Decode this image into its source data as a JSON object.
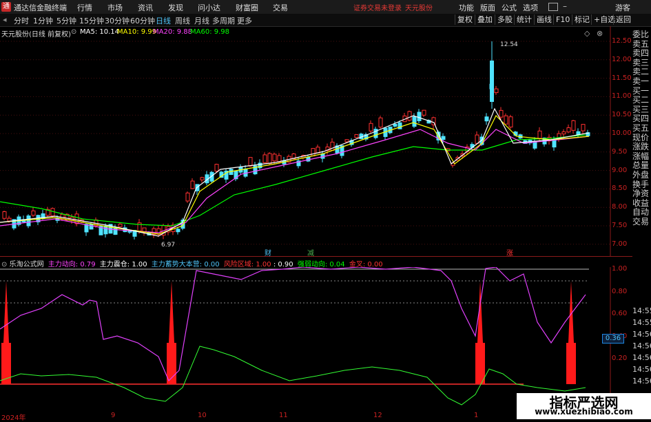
{
  "menubar": {
    "app_title": "通达信金融终端",
    "items": [
      "行情",
      "市场",
      "资讯",
      "发现",
      "问小达",
      "财富圈",
      "交易"
    ],
    "notice": "证券交易未登录",
    "notice_stock": "天元股份",
    "right_items": [
      "功能",
      "版面",
      "公式",
      "选项"
    ],
    "guest": "游客"
  },
  "periodbar": {
    "items": [
      "分时",
      "1分钟",
      "5分钟",
      "15分钟",
      "30分钟",
      "60分钟",
      "日线",
      "周线",
      "月线",
      "多周期",
      "更多"
    ],
    "active": "日线",
    "tools": [
      "复权",
      "叠加",
      "多股",
      "统计",
      "画线",
      "F10",
      "标记",
      "+自选",
      "返回"
    ]
  },
  "main_info": {
    "title": "天元股份(日线 前复权)",
    "ma5": "MA5: 10.14",
    "ma10": "MA10: 9.99",
    "ma20": "MA20: 9.88",
    "ma60": "MA60: 9.98",
    "colors": {
      "ma5": "#ffffff",
      "ma10": "#ffff00",
      "ma20": "#ff44ff",
      "ma60": "#00ff00"
    }
  },
  "price_axis": [
    "12.50",
    "12.00",
    "11.50",
    "11.00",
    "10.50",
    "10.00",
    "9.50",
    "9.00",
    "8.50",
    "8.00",
    "7.50",
    "7.00"
  ],
  "price_labels": {
    "high": "12.54",
    "low": "6.97"
  },
  "markers": [
    "财",
    "减",
    "涨"
  ],
  "sub_info": {
    "title": "乐淘公式网",
    "items": [
      {
        "label": "主力动向: 0.79",
        "color": "#ff44ff"
      },
      {
        "label": "主力震仓: 1.00",
        "color": "#ffffff"
      },
      {
        "label": "主力蓄势大本营: 0.00",
        "color": "#4fc3f7"
      },
      {
        "label": "风险区域: 1.00",
        "color": "#ff3333"
      },
      {
        "label": ": 0.90",
        "color": "#ffffff"
      },
      {
        "label": "强弱动向: 0.04",
        "color": "#00ff00"
      },
      {
        "label": "金叉: 0.00",
        "color": "#ff3333"
      }
    ]
  },
  "sub_axis": [
    "1.00",
    "0.80",
    "0.60",
    "0.40",
    "0.20"
  ],
  "sub_value_box": "0.36",
  "right_panel": [
    "委比",
    "卖五",
    "卖四",
    "卖三",
    "卖二",
    "卖一",
    "买一",
    "买二",
    "买三",
    "买四",
    "买五",
    "现价",
    "涨跌",
    "涨幅",
    "总量",
    "外盘",
    "换手",
    "净资",
    "收益",
    "自动",
    "交易"
  ],
  "time_list": [
    "14:55",
    "14:55",
    "14:56",
    "14:56",
    "14:56",
    "14:56",
    "14:56"
  ],
  "x_axis": [
    "2024年",
    "9",
    "10",
    "11",
    "12",
    "1"
  ],
  "watermark": {
    "line1": "指标严选网",
    "line2": "www.xuezhibiao.com"
  }
}
